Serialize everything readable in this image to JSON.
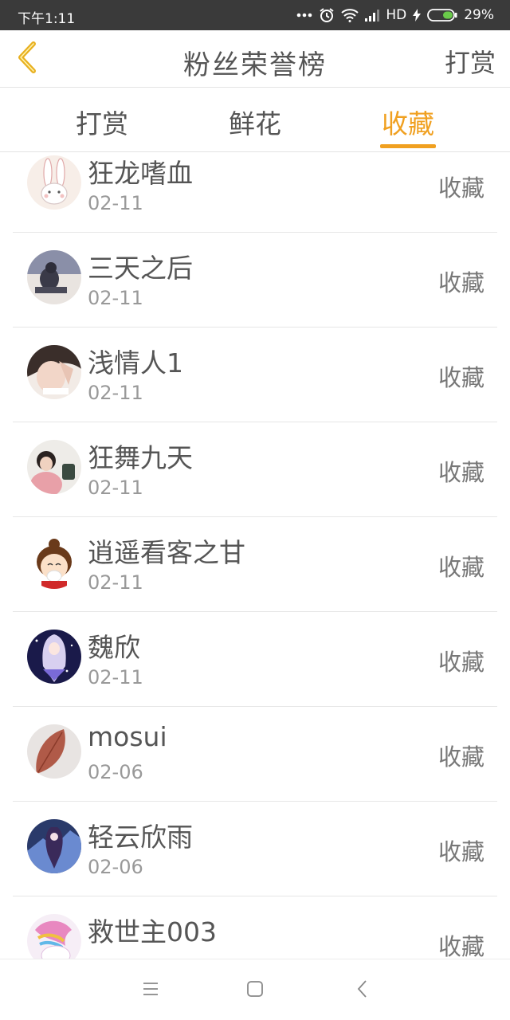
{
  "status_bar": {
    "time": "下午1:11",
    "network_label": "HD",
    "battery": "29%"
  },
  "header": {
    "title": "粉丝荣誉榜",
    "right_action": "打赏",
    "back_icon": "chevron-left-icon",
    "accent_color": "#f0a020"
  },
  "tabs": [
    {
      "label": "打赏",
      "active": false
    },
    {
      "label": "鲜花",
      "active": false
    },
    {
      "label": "收藏",
      "active": true
    }
  ],
  "fans": [
    {
      "name": "狂龙嗜血",
      "date": "02-11",
      "action": "收藏",
      "avatar": "rabbit-avatar"
    },
    {
      "name": "三天之后",
      "date": "02-11",
      "action": "收藏",
      "avatar": "person-sitting-avatar"
    },
    {
      "name": "浅情人1",
      "date": "02-11",
      "action": "收藏",
      "avatar": "girl-photo-avatar"
    },
    {
      "name": "狂舞九天",
      "date": "02-11",
      "action": "收藏",
      "avatar": "girl-pink-avatar"
    },
    {
      "name": "逍遥看客之甘",
      "date": "02-11",
      "action": "收藏",
      "avatar": "cartoon-kid-avatar"
    },
    {
      "name": "魏欣",
      "date": "02-11",
      "action": "收藏",
      "avatar": "anime-girl-avatar"
    },
    {
      "name": "mosui",
      "date": "02-06",
      "action": "收藏",
      "avatar": "leaf-avatar"
    },
    {
      "name": "轻云欣雨",
      "date": "02-06",
      "action": "收藏",
      "avatar": "anime-blue-avatar"
    },
    {
      "name": "救世主003",
      "date": "",
      "action": "收藏",
      "avatar": "pony-avatar"
    }
  ],
  "system_nav": {
    "icons": [
      "menu-icon",
      "home-square-icon",
      "back-arrow-icon"
    ]
  }
}
